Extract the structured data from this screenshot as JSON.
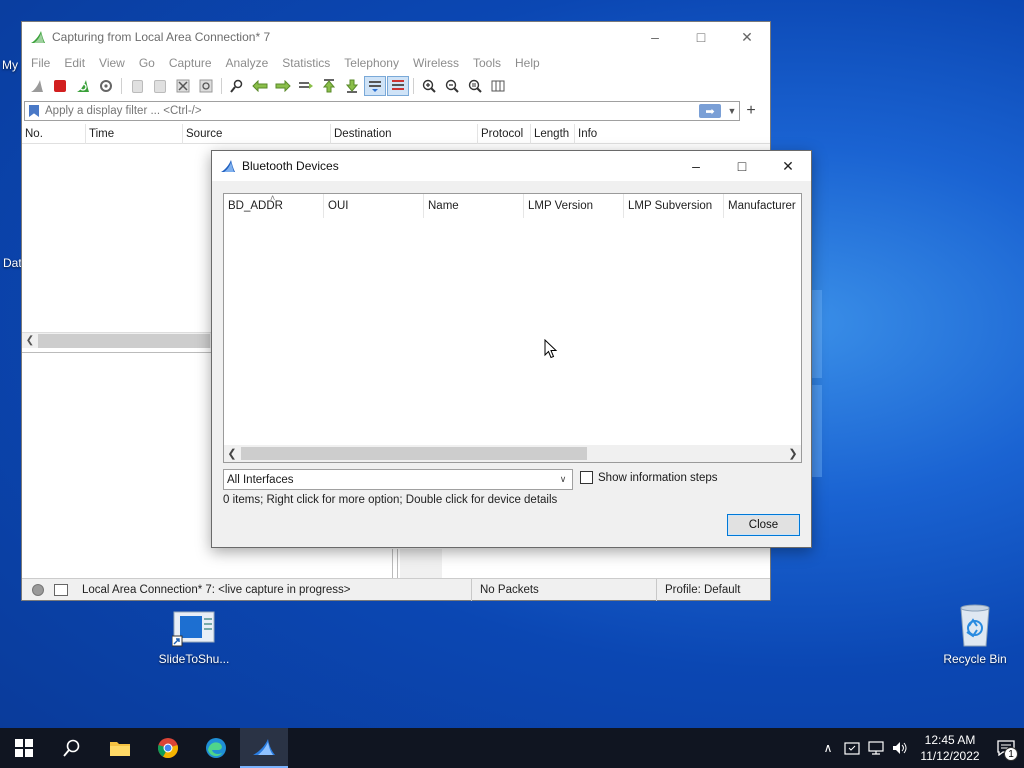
{
  "desktop": {
    "icons": [
      {
        "label": "SlideToShu..."
      },
      {
        "label": "Recycle Bin"
      }
    ],
    "peek_labels": [
      "My",
      "Dat"
    ]
  },
  "wireshark": {
    "title": "Capturing from Local Area Connection* 7",
    "menu": [
      "File",
      "Edit",
      "View",
      "Go",
      "Capture",
      "Analyze",
      "Statistics",
      "Telephony",
      "Wireless",
      "Tools",
      "Help"
    ],
    "filter_placeholder": "Apply a display filter ... <Ctrl-/>",
    "columns": [
      "No.",
      "Time",
      "Source",
      "Destination",
      "Protocol",
      "Length",
      "Info"
    ],
    "status": {
      "interface": "Local Area Connection* 7: <live capture in progress>",
      "packets": "No Packets",
      "profile": "Profile: Default"
    }
  },
  "bluetooth_dialog": {
    "title": "Bluetooth Devices",
    "columns": [
      "BD_ADDR",
      "OUI",
      "Name",
      "LMP Version",
      "LMP Subversion",
      "Manufacturer"
    ],
    "interface_select": "All Interfaces",
    "show_steps_label": "Show information steps",
    "show_steps_checked": false,
    "info_text": "0 items; Right click for more option; Double click for device details",
    "close_label": "Close"
  },
  "taskbar": {
    "time": "12:45 AM",
    "date": "11/12/2022",
    "notification_count": "1"
  },
  "colors": {
    "accent": "#0078d7",
    "desktop": "#0b47b3",
    "taskbar": "#101521"
  }
}
